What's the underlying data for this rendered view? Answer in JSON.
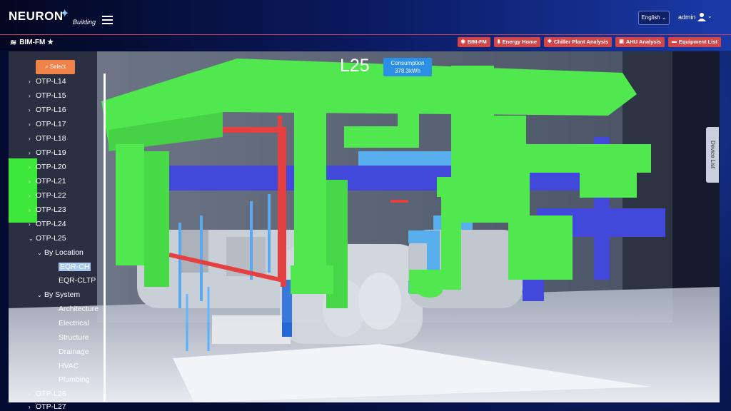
{
  "header": {
    "logo_text": "NEURON",
    "logo_sub": "Building",
    "language": "English",
    "user": "admin"
  },
  "module": {
    "title": "BIM-FM ★"
  },
  "nav": [
    {
      "label": "BIM-FM",
      "icon": "target-icon"
    },
    {
      "label": "Energy Home",
      "icon": "bar-chart-icon"
    },
    {
      "label": "Chiller Plant Analysis",
      "icon": "settings-icon"
    },
    {
      "label": "AHU Analysis",
      "icon": "image-icon"
    },
    {
      "label": "Equipment List",
      "icon": "folder-icon"
    }
  ],
  "sidebar": {
    "select_label": "Select",
    "tree": [
      {
        "label": "OTP-L14",
        "caret": "›"
      },
      {
        "label": "OTP-L15",
        "caret": "›"
      },
      {
        "label": "OTP-L16",
        "caret": "›"
      },
      {
        "label": "OTP-L17",
        "caret": "›"
      },
      {
        "label": "OTP-L18",
        "caret": "›"
      },
      {
        "label": "OTP-L19",
        "caret": "›"
      },
      {
        "label": "OTP-L20",
        "caret": "›"
      },
      {
        "label": "OTP-L21",
        "caret": "›"
      },
      {
        "label": "OTP-L22",
        "caret": "›"
      },
      {
        "label": "OTP-L23",
        "caret": "›"
      },
      {
        "label": "OTP-L24",
        "caret": "›"
      },
      {
        "label": "OTP-L25",
        "caret": "⌄"
      },
      {
        "label": "By Location",
        "caret": "⌄"
      },
      {
        "label": "EQR-CH",
        "caret": ""
      },
      {
        "label": "EQR-CLTP",
        "caret": ""
      },
      {
        "label": "By System",
        "caret": "⌄"
      },
      {
        "label": "Architecture",
        "caret": ""
      },
      {
        "label": "Electrical",
        "caret": ""
      },
      {
        "label": "Structure",
        "caret": ""
      },
      {
        "label": "Drainage",
        "caret": ""
      },
      {
        "label": "HVAC",
        "caret": ""
      },
      {
        "label": "Plumbing",
        "caret": ""
      },
      {
        "label": "OTP-L26",
        "caret": "›"
      },
      {
        "label": "OTP-L27",
        "caret": "›"
      }
    ]
  },
  "viewer": {
    "level": "L25",
    "consumption_title": "Consumption",
    "consumption_value": "378.3kWh",
    "device_list_label": "Device List"
  }
}
